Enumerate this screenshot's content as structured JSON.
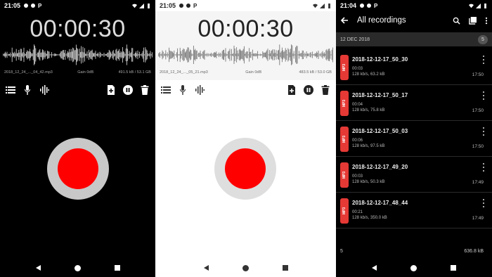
{
  "screen1": {
    "status": {
      "time": "21:05",
      "p": "P"
    },
    "timer": "00:00:30",
    "file": "2018_12_24_..._04_42.mp3",
    "gain": "Gain 0dB",
    "size": "491.5 kB / 53.1 GB"
  },
  "screen2": {
    "status": {
      "time": "21:05",
      "p": "P"
    },
    "timer": "00:00:30",
    "file": "2018_12_24_..._05_21.mp3",
    "gain": "Gain 0dB",
    "size": "483.5 kB / 53.0 GB"
  },
  "screen3": {
    "status": {
      "time": "21:04",
      "p": "P"
    },
    "title": "All recordings",
    "section": {
      "date": "12 DEC 2018",
      "count": "5"
    },
    "badge_label": "MP3",
    "recordings": [
      {
        "name": "2018-12-12-17_50_30",
        "duration": "00:03",
        "details": "128 kb/s, 63.2 kB",
        "time": "17:50"
      },
      {
        "name": "2018-12-12-17_50_17",
        "duration": "00:04",
        "details": "128 kb/s, 75.8 kB",
        "time": "17:50"
      },
      {
        "name": "2018-12-12-17_50_03",
        "duration": "00:06",
        "details": "128 kb/s, 97.5 kB",
        "time": "17:50"
      },
      {
        "name": "2018-12-12-17_49_20",
        "duration": "00:03",
        "details": "128 kb/s, 50.3 kB",
        "time": "17:49"
      },
      {
        "name": "2018-12-12-17_48_44",
        "duration": "00:21",
        "details": "128 kb/s, 350.0 kB",
        "time": "17:49"
      }
    ],
    "footer": {
      "count": "5",
      "total": "636.8 kB"
    }
  },
  "colors": {
    "record": "#ff0000",
    "mp3_badge": "#e53935"
  },
  "icons": [
    "list-icon",
    "mic-icon",
    "waveform-icon",
    "new-file-icon",
    "pause-icon",
    "delete-icon",
    "back-arrow-icon",
    "search-icon",
    "library-icon",
    "more-vert-icon"
  ]
}
